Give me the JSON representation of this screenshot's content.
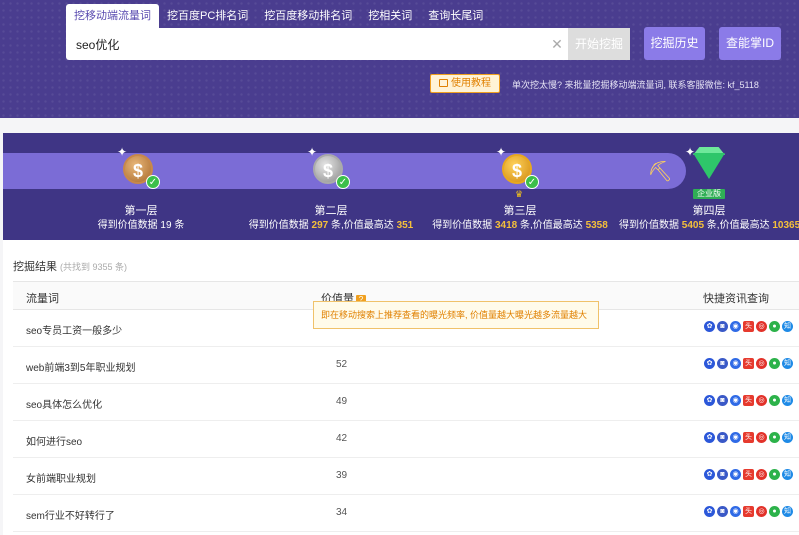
{
  "header": {
    "tabs": [
      {
        "label": "挖移动端流量词",
        "active": true
      },
      {
        "label": "挖百度PC排名词",
        "active": false
      },
      {
        "label": "挖百度移动排名词",
        "active": false
      },
      {
        "label": "挖相关词",
        "active": false
      },
      {
        "label": "查询长尾词",
        "active": false
      }
    ],
    "search": {
      "value": "seo优化",
      "placeholder": ""
    },
    "start_label": "开始挖掘",
    "history_label": "挖掘历史",
    "query_id_label": "查能掌ID",
    "tutorial_label": "使用教程",
    "notice": "单次挖太慢? 来批量挖掘移动端流量词, 联系客服微信: kf_5118"
  },
  "levels": [
    {
      "name": "第一层",
      "desc_prefix": "得到价值数据 19 条",
      "count": "",
      "mid": "",
      "max": ""
    },
    {
      "name": "第二层",
      "desc_prefix": "得到价值数据 ",
      "count": "297",
      "mid": " 条,价值最高达 ",
      "max": "351"
    },
    {
      "name": "第三层",
      "desc_prefix": "得到价值数据 ",
      "count": "3418",
      "mid": " 条,价值最高达 ",
      "max": "5358"
    },
    {
      "name": "第四层",
      "desc_prefix": "得到价值数据 ",
      "count": "5405",
      "mid": " 条,价值最高达 ",
      "max": "10365",
      "badge": "企业版"
    }
  ],
  "results": {
    "title": "挖掘结果",
    "count_text": "(共找到 9355 条)",
    "columns": {
      "keyword": "流量词",
      "value": "价值量",
      "links": "快捷资讯查询"
    },
    "tooltip": "即在移动搜索上推荐查看的曝光频率, 价值量越大曝光越多流量越大",
    "rows": [
      {
        "keyword": "seo专员工资一般多少",
        "value": ""
      },
      {
        "keyword": "web前端3到5年职业规划",
        "value": "52"
      },
      {
        "keyword": "seo具体怎么优化",
        "value": "49"
      },
      {
        "keyword": "如何进行seo",
        "value": "42"
      },
      {
        "keyword": "女前端职业规划",
        "value": "39"
      },
      {
        "keyword": "sem行业不好转行了",
        "value": "34"
      }
    ]
  },
  "quick_links": [
    {
      "icon": "paw-icon",
      "glyph": "✿",
      "color": "#2b57d9"
    },
    {
      "icon": "mobile-search-icon",
      "glyph": "◙",
      "color": "#3a59c7"
    },
    {
      "icon": "zhidao-icon",
      "glyph": "◉",
      "color": "#2f6ae6"
    },
    {
      "icon": "toutiao-icon",
      "glyph": "头",
      "color": "#e63a2e"
    },
    {
      "icon": "weibo-icon",
      "glyph": "◎",
      "color": "#e2322a"
    },
    {
      "icon": "wechat-icon",
      "glyph": "●",
      "color": "#2cb24a"
    },
    {
      "icon": "zhihu-icon",
      "glyph": "知",
      "color": "#1e8ae6"
    }
  ]
}
